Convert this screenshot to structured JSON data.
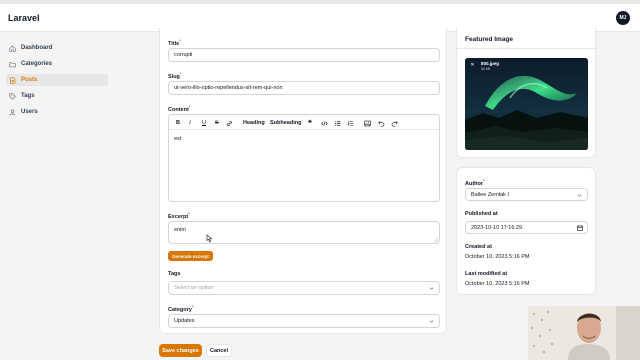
{
  "app": {
    "brand": "Laravel"
  },
  "user": {
    "initials": "MJ"
  },
  "sidebar": {
    "items": [
      {
        "label": "Dashboard",
        "icon": "home-icon",
        "active": false
      },
      {
        "label": "Categories",
        "icon": "folder-icon",
        "active": false
      },
      {
        "label": "Posts",
        "icon": "document-icon",
        "active": true
      },
      {
        "label": "Tags",
        "icon": "tag-icon",
        "active": false
      },
      {
        "label": "Users",
        "icon": "users-icon",
        "active": false
      }
    ]
  },
  "form": {
    "title": {
      "label": "Title",
      "value": "corrupti"
    },
    "slug": {
      "label": "Slug",
      "value": "ut-vero-illo-optio-repellendus-sit-rem-qui-non"
    },
    "content": {
      "label": "Content",
      "toolbar": {
        "heading": "Heading",
        "subheading": "Subheading"
      },
      "value": "est"
    },
    "excerpt": {
      "label": "Excerpt",
      "value": "enim",
      "generate_label": "Generate excerpt"
    },
    "tags": {
      "label": "Tags",
      "placeholder": "Select an option"
    },
    "category": {
      "label": "Category",
      "value": "Updates"
    }
  },
  "actions": {
    "save": "Save changes",
    "cancel": "Cancel"
  },
  "featured": {
    "title": "Featured Image",
    "file_name": "800.jpeg",
    "file_size": "52 kB"
  },
  "meta": {
    "author": {
      "label": "Author",
      "value": "Bailee Zemlak I"
    },
    "published_at": {
      "label": "Published at",
      "value": "2023-10-10  17:16:29"
    },
    "created_at": {
      "label": "Created at",
      "value": "October 10, 2023 5:16 PM"
    },
    "modified_at": {
      "label": "Last modified at",
      "value": "October 10, 2023 5:16 PM"
    }
  },
  "colors": {
    "accent": "#d97706",
    "border": "#d1d5db",
    "background": "#f4f4f5"
  }
}
